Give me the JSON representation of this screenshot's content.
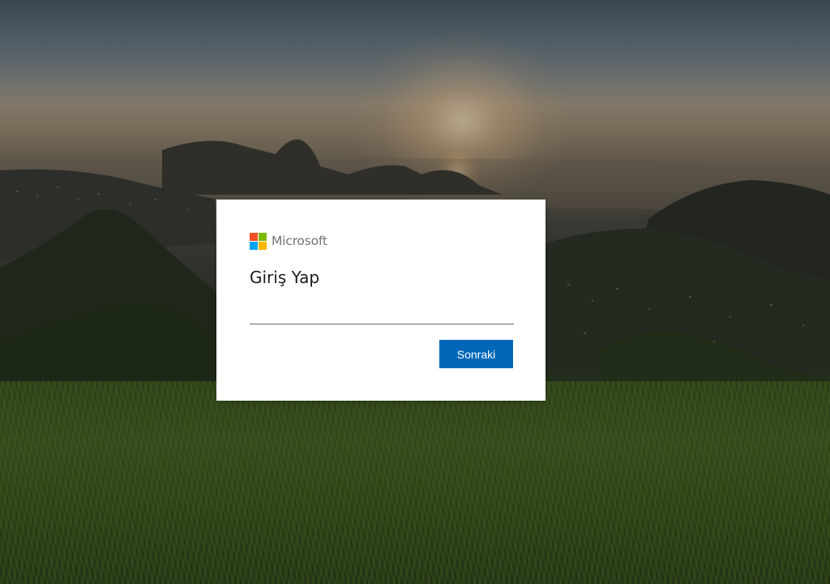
{
  "brand": {
    "name": "Microsoft",
    "logo_colors": [
      "#f25022",
      "#7fba00",
      "#00a4ef",
      "#ffb900"
    ]
  },
  "signin": {
    "title": "Giriş Yap",
    "email_value": "",
    "email_placeholder": "",
    "next_label": "Sonraki"
  },
  "theme": {
    "accent": "#0067b8",
    "background_scene": "sunset-over-bay-with-mountains-and-grass"
  }
}
